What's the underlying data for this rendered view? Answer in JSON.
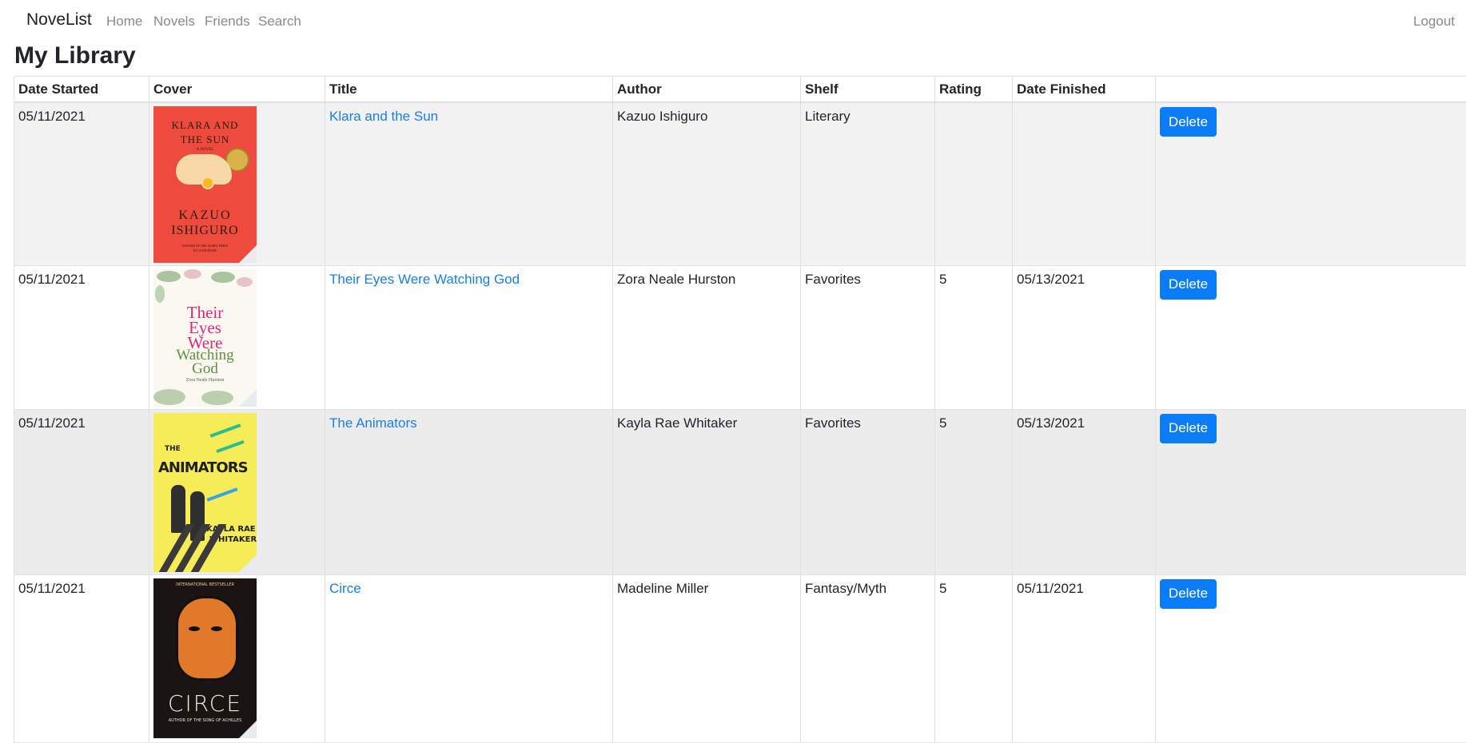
{
  "nav": {
    "brand": "NoveList",
    "links": [
      "Home",
      "Novels",
      "Friends",
      "Search"
    ],
    "logout": "Logout"
  },
  "page_title": "My Library",
  "table": {
    "columns": [
      "Date Started",
      "Cover",
      "Title",
      "Author",
      "Shelf",
      "Rating",
      "Date Finished",
      ""
    ],
    "rows": [
      {
        "date_started": "05/11/2021",
        "cover_icon": "book-cover-image",
        "cover_text": [
          "KLARA AND",
          "THE SUN",
          "A NOVEL",
          "KAZUO",
          "ISHIGURO",
          "WINNER OF THE NOBEL PRIZE",
          "IN LITERATURE"
        ],
        "title": "Klara and the Sun",
        "author": "Kazuo Ishiguro",
        "shelf": "Literary",
        "rating": "",
        "date_finished": "",
        "action": "Delete"
      },
      {
        "date_started": "05/11/2021",
        "cover_icon": "book-cover-image",
        "cover_text": [
          "Their",
          "Eyes",
          "Were",
          "Watching",
          "God",
          "Zora Neale Hurston"
        ],
        "title": "Their Eyes Were Watching God",
        "author": "Zora Neale Hurston",
        "shelf": "Favorites",
        "rating": "5",
        "date_finished": "05/13/2021",
        "action": "Delete"
      },
      {
        "date_started": "05/11/2021",
        "cover_icon": "book-cover-image",
        "cover_text": [
          "THE",
          "ANIMATORS",
          "KAYLA RAE",
          "WHITAKER"
        ],
        "title": "The Animators",
        "author": "Kayla Rae Whitaker",
        "shelf": "Favorites",
        "rating": "5",
        "date_finished": "05/13/2021",
        "action": "Delete"
      },
      {
        "date_started": "05/11/2021",
        "cover_icon": "book-cover-image",
        "cover_text": [
          "INTERNATIONAL BESTSELLER",
          "CIRCE",
          "AUTHOR OF THE SONG OF ACHILLES"
        ],
        "title": "Circe",
        "author": "Madeline Miller",
        "shelf": "Fantasy/Myth",
        "rating": "5",
        "date_finished": "05/11/2021",
        "action": "Delete"
      }
    ]
  },
  "colors": {
    "link": "#1a7fe6",
    "button": "#0a7cf7",
    "row_stripe": "#f2f2f2"
  }
}
